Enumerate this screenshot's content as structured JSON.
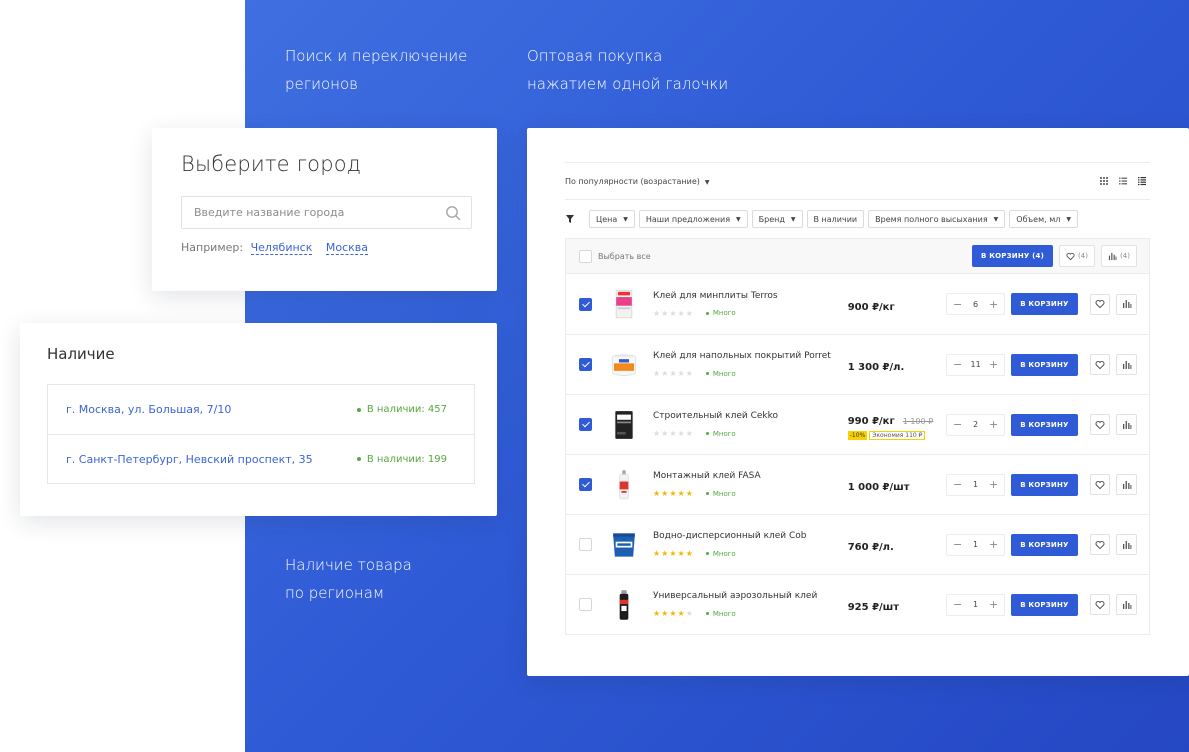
{
  "captions": {
    "regions": [
      "Поиск и переключение",
      "регионов"
    ],
    "wholesale": [
      "Оптовая покупка",
      "нажатием одной галочки"
    ],
    "availability": [
      "Наличие товара",
      "по регионам"
    ]
  },
  "city_card": {
    "title": "Выберите город",
    "search_placeholder": "Введите название города",
    "example_label": "Например:",
    "example_cities": [
      "Челябинск",
      "Москва"
    ]
  },
  "avail_card": {
    "title": "Наличие",
    "rows": [
      {
        "address": "г. Москва, ул. Большая, 7/10",
        "stock": "В наличии: 457"
      },
      {
        "address": "г. Санкт-Петербург, Невский проспект, 35",
        "stock": "В наличии: 199"
      }
    ]
  },
  "catalog": {
    "sort_label": "По популярности (возрастание)",
    "filters": [
      "Цена",
      "Наши предложения",
      "Бренд",
      "В наличии",
      "Время полного высыхания",
      "Объем, мл"
    ],
    "select_all": "Выбрать все",
    "cart_all_label": "В КОРЗИНУ (4)",
    "fav_count": "(4)",
    "compare_count": "(4)",
    "add_to_cart": "В КОРЗИНУ",
    "products": [
      {
        "name": "Клей для минплиты Terros",
        "price": "900 ₽/кг",
        "qty": "6",
        "stock": "Много",
        "rating": 0,
        "checked": true
      },
      {
        "name": "Клей для напольных покрытий Porret",
        "price": "1 300 ₽/л.",
        "qty": "11",
        "stock": "Много",
        "rating": 0,
        "checked": true
      },
      {
        "name": "Строительный клей Cekko",
        "price": "990 ₽/кг",
        "old_price": "1 100 ₽",
        "discount": "-10%",
        "saving": "Экономия 110 ₽",
        "qty": "2",
        "stock": "Много",
        "rating": 0,
        "checked": true
      },
      {
        "name": "Монтажный клей FASA",
        "price": "1 000 ₽/шт",
        "qty": "1",
        "stock": "Много",
        "rating": 5,
        "checked": true
      },
      {
        "name": "Водно-дисперсионный клей Cob",
        "price": "760 ₽/л.",
        "qty": "1",
        "stock": "Много",
        "rating": 5,
        "checked": false
      },
      {
        "name": "Универсальный аэрозольный клей",
        "price": "925 ₽/шт",
        "qty": "1",
        "stock": "Много",
        "rating": 4,
        "checked": false
      }
    ]
  }
}
